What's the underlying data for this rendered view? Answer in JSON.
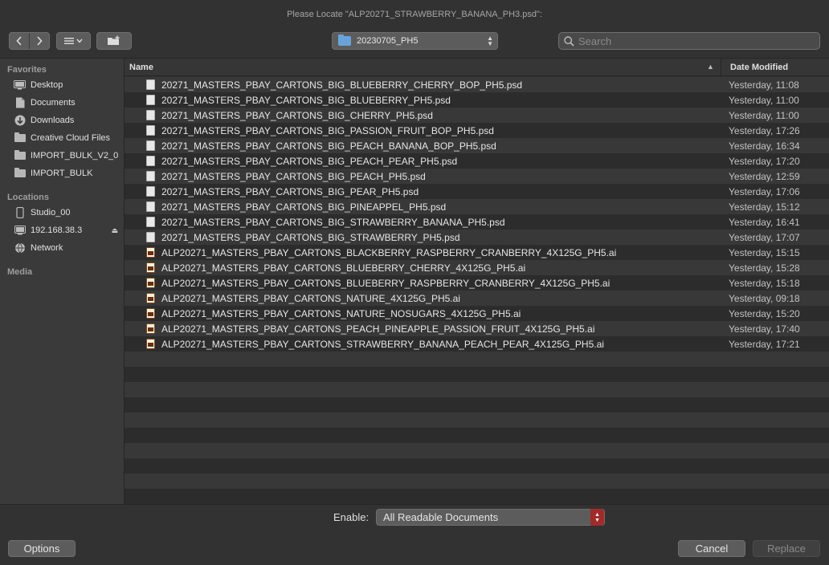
{
  "window": {
    "title": "Please Locate \"ALP20271_STRAWBERRY_BANANA_PH3.psd\":"
  },
  "toolbar": {
    "back_icon": "chevron-left",
    "forward_icon": "chevron-right",
    "view_icon": "list-view",
    "new_folder_icon": "new-folder",
    "location": "20230705_PH5",
    "search_placeholder": "Search"
  },
  "sidebar": {
    "favorites_label": "Favorites",
    "favorites": [
      {
        "label": "Desktop",
        "icon": "desktop"
      },
      {
        "label": "Documents",
        "icon": "document"
      },
      {
        "label": "Downloads",
        "icon": "download"
      },
      {
        "label": "Creative Cloud Files",
        "icon": "folder"
      },
      {
        "label": "IMPORT_BULK_V2_0",
        "icon": "folder"
      },
      {
        "label": "IMPORT_BULK",
        "icon": "folder"
      }
    ],
    "locations_label": "Locations",
    "locations": [
      {
        "label": "Studio_00",
        "icon": "drive"
      },
      {
        "label": "192.168.38.3",
        "icon": "display",
        "eject": "⏏"
      },
      {
        "label": "Network",
        "icon": "globe"
      }
    ],
    "media_label": "Media"
  },
  "list": {
    "col_name": "Name",
    "col_date": "Date Modified",
    "files": [
      {
        "name": "20271_MASTERS_PBAY_CARTONS_BIG_BLUEBERRY_CHERRY_BOP_PH5.psd",
        "date": "Yesterday, 11:08",
        "type": "psd"
      },
      {
        "name": "20271_MASTERS_PBAY_CARTONS_BIG_BLUEBERRY_PH5.psd",
        "date": "Yesterday, 11:00",
        "type": "psd"
      },
      {
        "name": "20271_MASTERS_PBAY_CARTONS_BIG_CHERRY_PH5.psd",
        "date": "Yesterday, 11:00",
        "type": "psd"
      },
      {
        "name": "20271_MASTERS_PBAY_CARTONS_BIG_PASSION_FRUIT_BOP_PH5.psd",
        "date": "Yesterday, 17:26",
        "type": "psd"
      },
      {
        "name": "20271_MASTERS_PBAY_CARTONS_BIG_PEACH_BANANA_BOP_PH5.psd",
        "date": "Yesterday, 16:34",
        "type": "psd"
      },
      {
        "name": "20271_MASTERS_PBAY_CARTONS_BIG_PEACH_PEAR_PH5.psd",
        "date": "Yesterday, 17:20",
        "type": "psd"
      },
      {
        "name": "20271_MASTERS_PBAY_CARTONS_BIG_PEACH_PH5.psd",
        "date": "Yesterday, 12:59",
        "type": "psd"
      },
      {
        "name": "20271_MASTERS_PBAY_CARTONS_BIG_PEAR_PH5.psd",
        "date": "Yesterday, 17:06",
        "type": "psd"
      },
      {
        "name": "20271_MASTERS_PBAY_CARTONS_BIG_PINEAPPEL_PH5.psd",
        "date": "Yesterday, 15:12",
        "type": "psd"
      },
      {
        "name": "20271_MASTERS_PBAY_CARTONS_BIG_STRAWBERRY_BANANA_PH5.psd",
        "date": "Yesterday, 16:41",
        "type": "psd"
      },
      {
        "name": "20271_MASTERS_PBAY_CARTONS_BIG_STRAWBERRY_PH5.psd",
        "date": "Yesterday, 17:07",
        "type": "psd"
      },
      {
        "name": "ALP20271_MASTERS_PBAY_CARTONS_BLACKBERRY_RASPBERRY_CRANBERRY_4X125G_PH5.ai",
        "date": "Yesterday, 15:15",
        "type": "ai"
      },
      {
        "name": "ALP20271_MASTERS_PBAY_CARTONS_BLUEBERRY_CHERRY_4X125G_PH5.ai",
        "date": "Yesterday, 15:28",
        "type": "ai"
      },
      {
        "name": "ALP20271_MASTERS_PBAY_CARTONS_BLUEBERRY_RASPBERRY_CRANBERRY_4X125G_PH5.ai",
        "date": "Yesterday, 15:18",
        "type": "ai"
      },
      {
        "name": "ALP20271_MASTERS_PBAY_CARTONS_NATURE_4X125G_PH5.ai",
        "date": "Yesterday, 09:18",
        "type": "ai"
      },
      {
        "name": "ALP20271_MASTERS_PBAY_CARTONS_NATURE_NOSUGARS_4X125G_PH5.ai",
        "date": "Yesterday, 15:20",
        "type": "ai"
      },
      {
        "name": "ALP20271_MASTERS_PBAY_CARTONS_PEACH_PINEAPPLE_PASSION_FRUIT_4X125G_PH5.ai",
        "date": "Yesterday, 17:40",
        "type": "ai"
      },
      {
        "name": "ALP20271_MASTERS_PBAY_CARTONS_STRAWBERRY_BANANA_PEACH_PEAR_4X125G_PH5.ai",
        "date": "Yesterday, 17:21",
        "type": "ai"
      }
    ]
  },
  "footer": {
    "enable_label": "Enable:",
    "enable_value": "All Readable Documents",
    "options_label": "Options",
    "cancel_label": "Cancel",
    "replace_label": "Replace"
  }
}
